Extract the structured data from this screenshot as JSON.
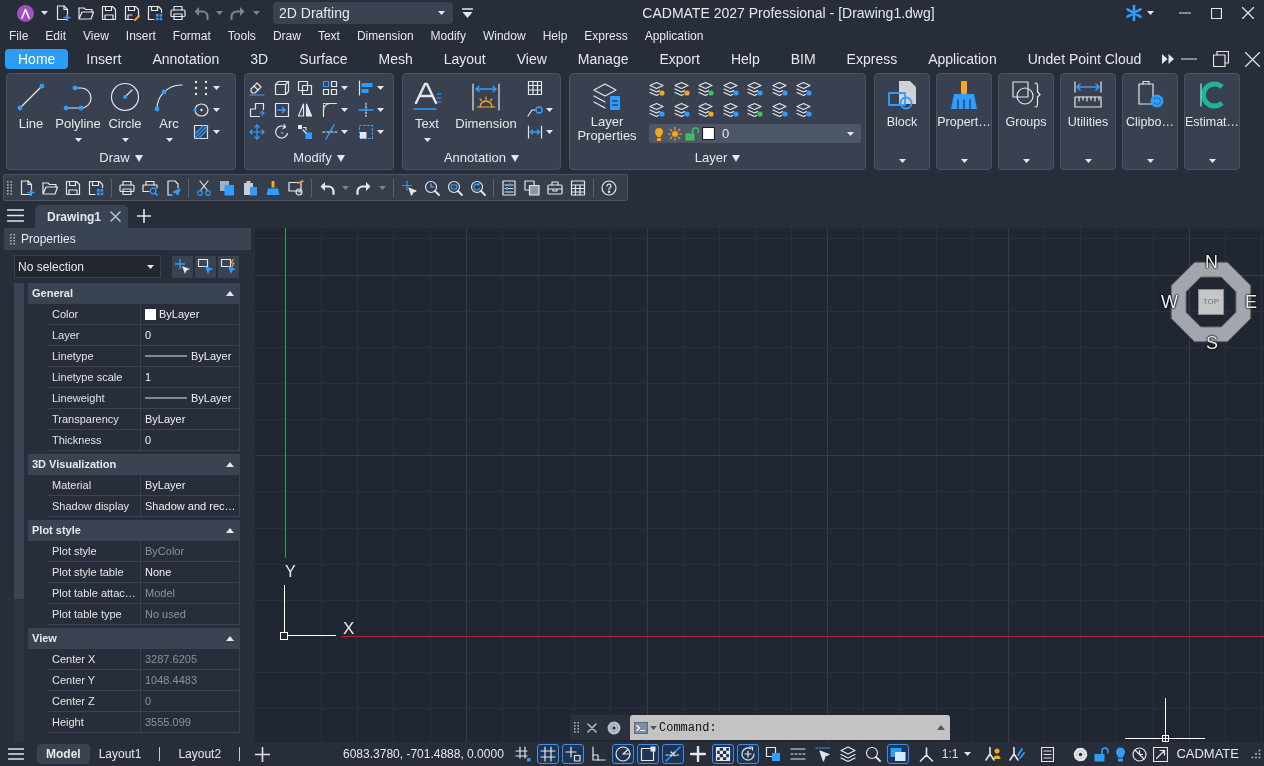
{
  "title_bar": {
    "workspace": "2D Drafting",
    "title": "CADMATE 2027 Professional - [Drawing1.dwg]"
  },
  "menu": [
    "File",
    "Edit",
    "View",
    "Insert",
    "Format",
    "Tools",
    "Draw",
    "Text",
    "Dimension",
    "Modify",
    "Window",
    "Help",
    "Express",
    "Application"
  ],
  "ribbon_tabs": [
    {
      "label": "Home",
      "selected": true
    },
    {
      "label": "Insert",
      "selected": false
    },
    {
      "label": "Annotation",
      "selected": false
    },
    {
      "label": "3D",
      "selected": false
    },
    {
      "label": "Surface",
      "selected": false
    },
    {
      "label": "Mesh",
      "selected": false
    },
    {
      "label": "Layout",
      "selected": false
    },
    {
      "label": "View",
      "selected": false
    },
    {
      "label": "Manage",
      "selected": false
    },
    {
      "label": "Export",
      "selected": false
    },
    {
      "label": "Help",
      "selected": false
    },
    {
      "label": "BIM",
      "selected": false
    },
    {
      "label": "Express",
      "selected": false
    },
    {
      "label": "Application",
      "selected": false
    },
    {
      "label": "Undet Point Cloud",
      "selected": false
    }
  ],
  "ribbon": {
    "draw": {
      "title": "Draw",
      "tools": [
        {
          "label": "Line",
          "dropdown": false
        },
        {
          "label": "Polyline",
          "dropdown": true
        },
        {
          "label": "Circle",
          "dropdown": true
        },
        {
          "label": "Arc",
          "dropdown": true
        }
      ]
    },
    "modify": {
      "title": "Modify"
    },
    "annotation": {
      "title": "Annotation",
      "tools": [
        {
          "label": "Text",
          "dropdown": true
        },
        {
          "label": "Dimension",
          "dropdown": false
        }
      ]
    },
    "layer": {
      "title": "Layer",
      "button": "Layer Properties",
      "current_layer": "0"
    },
    "buttons": [
      {
        "label": "Block"
      },
      {
        "label": "Propert…"
      },
      {
        "label": "Groups"
      },
      {
        "label": "Utilities"
      },
      {
        "label": "Clipbo…"
      },
      {
        "label": "Estimat…"
      }
    ]
  },
  "document_tabs": [
    {
      "label": "Drawing1",
      "selected": true
    }
  ],
  "properties": {
    "title": "Properties",
    "selection": "No selection",
    "sections": [
      {
        "title": "General",
        "expanded": true,
        "rows": [
          {
            "label": "Color",
            "value": "ByLayer",
            "kind": "swatch",
            "disabled": false
          },
          {
            "label": "Layer",
            "value": "0",
            "kind": "text",
            "disabled": false
          },
          {
            "label": "Linetype",
            "value": "ByLayer",
            "kind": "line",
            "disabled": false
          },
          {
            "label": "Linetype scale",
            "value": "1",
            "kind": "text",
            "disabled": false
          },
          {
            "label": "Lineweight",
            "value": "ByLayer",
            "kind": "line",
            "disabled": false
          },
          {
            "label": "Transparency",
            "value": "ByLayer",
            "kind": "text",
            "disabled": false
          },
          {
            "label": "Thickness",
            "value": "0",
            "kind": "text",
            "disabled": false
          }
        ]
      },
      {
        "title": "3D Visualization",
        "expanded": true,
        "rows": [
          {
            "label": "Material",
            "value": "ByLayer",
            "kind": "text",
            "disabled": false
          },
          {
            "label": "Shadow display",
            "value": "Shadow and rec…",
            "kind": "text",
            "disabled": false
          }
        ]
      },
      {
        "title": "Plot style",
        "expanded": true,
        "rows": [
          {
            "label": "Plot style",
            "value": "ByColor",
            "kind": "text",
            "disabled": true
          },
          {
            "label": "Plot style table",
            "value": "None",
            "kind": "text",
            "disabled": false
          },
          {
            "label": "Plot table attac…",
            "value": "Model",
            "kind": "text",
            "disabled": true
          },
          {
            "label": "Plot table type",
            "value": "No used",
            "kind": "text",
            "disabled": true
          }
        ]
      },
      {
        "title": "View",
        "expanded": true,
        "rows": [
          {
            "label": "Center X",
            "value": "3287.6205",
            "kind": "text",
            "disabled": true
          },
          {
            "label": "Center Y",
            "value": "1048.4483",
            "kind": "text",
            "disabled": true
          },
          {
            "label": "Center Z",
            "value": "0",
            "kind": "text",
            "disabled": true
          },
          {
            "label": "Height",
            "value": "3555.099",
            "kind": "text",
            "disabled": true
          }
        ]
      }
    ]
  },
  "canvas": {
    "ucs": {
      "x": "X",
      "y": "Y"
    },
    "viewcube": {
      "north": "N",
      "east": "E",
      "south": "S",
      "west": "W",
      "face": "TOP"
    }
  },
  "command_line": {
    "prompt": "Command:"
  },
  "layout_tabs": [
    {
      "label": "Model",
      "selected": true
    },
    {
      "label": "Layout1",
      "selected": false
    },
    {
      "label": "Layout2",
      "selected": false
    }
  ],
  "status_bar": {
    "coordinates": "6083.3780, -701.4888, 0.0000",
    "toggles": [
      {
        "on": false
      },
      {
        "on": true
      },
      {
        "on": true
      },
      {
        "on": false
      },
      {
        "on": true
      },
      {
        "on": true
      },
      {
        "on": true
      },
      {
        "on": false
      },
      {
        "on": true
      },
      {
        "on": true
      },
      {
        "on": false
      },
      {
        "on": false
      },
      {
        "on": false
      },
      {
        "on": false
      },
      {
        "on": false
      },
      {
        "on": true
      }
    ],
    "scale": "1:1",
    "workspace": "CADMATE"
  }
}
